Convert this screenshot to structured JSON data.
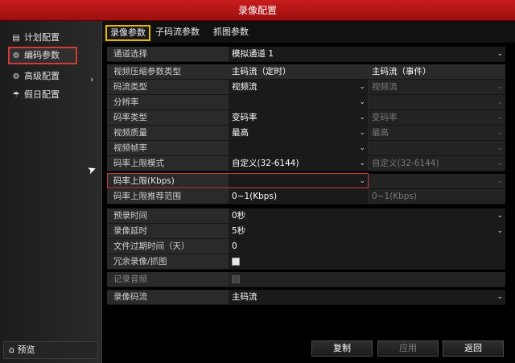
{
  "window": {
    "title": "录像配置"
  },
  "sidebar": {
    "items": [
      {
        "label": "计划配置",
        "icon": "schedule-icon",
        "glyph": "▤"
      },
      {
        "label": "编码参数",
        "icon": "encode-gear-icon",
        "glyph": "⚙"
      },
      {
        "label": "高级配置",
        "icon": "advanced-icon",
        "glyph": "⚙"
      },
      {
        "label": "假日配置",
        "icon": "umbrella-icon",
        "glyph": "☂"
      }
    ],
    "active_index": 1,
    "arrow": "›",
    "preview_label": "预览",
    "preview_icon": "home-icon",
    "preview_glyph": "⌂"
  },
  "tabs": [
    {
      "label": "录像参数",
      "active": true
    },
    {
      "label": "子码流参数",
      "active": false
    },
    {
      "label": "抓图参数",
      "active": false
    }
  ],
  "form": {
    "channel_label": "通道选择",
    "channel_value": "模拟通道 1",
    "stream_type_header_label": "视频压缩参数类型",
    "col1_header": "主码流（定时）",
    "col2_header": "主码流（事件）",
    "rows": [
      {
        "label": "码流类型",
        "v1": "视频流",
        "v2": "视频流"
      },
      {
        "label": "分辨率",
        "v1": "",
        "v2": ""
      },
      {
        "label": "码率类型",
        "v1": "变码率",
        "v2": "变码率"
      },
      {
        "label": "视频质量",
        "v1": "最高",
        "v2": "最高"
      },
      {
        "label": "视频帧率",
        "v1": "",
        "v2": ""
      },
      {
        "label": "码率上限模式",
        "v1": "自定义(32-6144)",
        "v2": "自定义(32-6144)"
      },
      {
        "label": "码率上限(Kbps)",
        "v1": "",
        "v2": ""
      },
      {
        "label": "码率上限推荐范围",
        "v1": "0~1(Kbps)",
        "v2": "0~1(Kbps)"
      }
    ],
    "prerecord_label": "预录时间",
    "prerecord_value": "0秒",
    "postrecord_label": "录像延时",
    "postrecord_value": "5秒",
    "expire_label": "文件过期时间（天）",
    "expire_value": "0",
    "redundant_label": "冗余录像/抓图",
    "redundant_checked": true,
    "audio_label": "记录音频",
    "audio_checked": false,
    "stream_label": "录像码流",
    "stream_value": "主码流",
    "dropdown_arrow": "⌄"
  },
  "buttons": {
    "copy": "复制",
    "apply": "应用",
    "back": "返回"
  }
}
